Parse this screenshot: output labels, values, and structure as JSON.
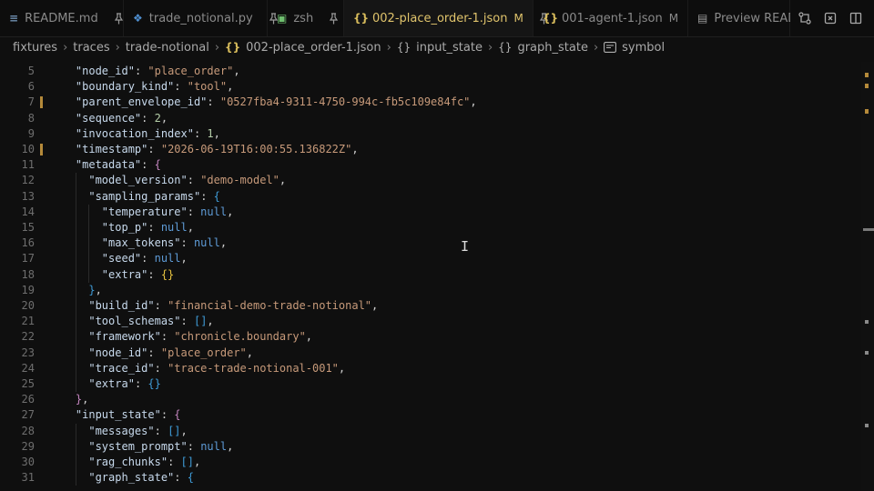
{
  "tabs": [
    {
      "label": "README.md",
      "icon": "info-icon",
      "glyph": "≡",
      "icon_color": "#6f8fb0",
      "modified": "",
      "pinned": true,
      "active": false
    },
    {
      "label": "trade_notional.py",
      "icon": "python-icon",
      "glyph": "❖",
      "icon_color": "#4f8fd0",
      "modified": "",
      "pinned": true,
      "active": false
    },
    {
      "label": "zsh",
      "icon": "terminal-icon",
      "glyph": "▣",
      "icon_color": "#6fbf6f",
      "modified": "",
      "pinned": true,
      "active": false
    },
    {
      "label": "002-place_order-1.json",
      "icon": "json-icon",
      "glyph": "{}",
      "icon_color": "#d9bd5c",
      "modified": "M",
      "pinned": true,
      "active": true
    },
    {
      "label": "001-agent-1.json",
      "icon": "json-icon",
      "glyph": "{}",
      "icon_color": "#d9bd5c",
      "modified": "M",
      "pinned": false,
      "active": false
    },
    {
      "label": "Preview READ",
      "icon": "preview-icon",
      "glyph": "▤",
      "icon_color": "#9a9a9a",
      "modified": "",
      "pinned": false,
      "active": false
    }
  ],
  "breadcrumb": {
    "parts": [
      "fixtures",
      "traces",
      "trade-notional"
    ],
    "file": "002-place_order-1.json",
    "obj1": "input_state",
    "obj2": "graph_state",
    "symbol": "symbol"
  },
  "code": {
    "first_line": 5,
    "modified_lines": [
      7,
      10
    ],
    "lines": [
      [
        [
          "p",
          "    "
        ],
        [
          "k",
          "\"node_id\""
        ],
        [
          "p",
          ": "
        ],
        [
          "s",
          "\"place_order\""
        ],
        [
          "p",
          ","
        ]
      ],
      [
        [
          "p",
          "    "
        ],
        [
          "k",
          "\"boundary_kind\""
        ],
        [
          "p",
          ": "
        ],
        [
          "s",
          "\"tool\""
        ],
        [
          "p",
          ","
        ]
      ],
      [
        [
          "p",
          "    "
        ],
        [
          "k",
          "\"parent_envelope_id\""
        ],
        [
          "p",
          ": "
        ],
        [
          "s",
          "\"0527fba4-9311-4750-994c-fb5c109e84fc\""
        ],
        [
          "p",
          ","
        ]
      ],
      [
        [
          "p",
          "    "
        ],
        [
          "k",
          "\"sequence\""
        ],
        [
          "p",
          ": "
        ],
        [
          "n",
          "2"
        ],
        [
          "p",
          ","
        ]
      ],
      [
        [
          "p",
          "    "
        ],
        [
          "k",
          "\"invocation_index\""
        ],
        [
          "p",
          ": "
        ],
        [
          "n",
          "1"
        ],
        [
          "p",
          ","
        ]
      ],
      [
        [
          "p",
          "    "
        ],
        [
          "k",
          "\"timestamp\""
        ],
        [
          "p",
          ": "
        ],
        [
          "s",
          "\"2026-06-19T16:00:55.136822Z\""
        ],
        [
          "p",
          ","
        ]
      ],
      [
        [
          "p",
          "    "
        ],
        [
          "k",
          "\"metadata\""
        ],
        [
          "p",
          ": "
        ],
        [
          "b1",
          "{"
        ]
      ],
      [
        [
          "p",
          "      "
        ],
        [
          "k",
          "\"model_version\""
        ],
        [
          "p",
          ": "
        ],
        [
          "s",
          "\"demo-model\""
        ],
        [
          "p",
          ","
        ]
      ],
      [
        [
          "p",
          "      "
        ],
        [
          "k",
          "\"sampling_params\""
        ],
        [
          "p",
          ": "
        ],
        [
          "b3",
          "{"
        ]
      ],
      [
        [
          "p",
          "        "
        ],
        [
          "k",
          "\"temperature\""
        ],
        [
          "p",
          ": "
        ],
        [
          "kw",
          "null"
        ],
        [
          "p",
          ","
        ]
      ],
      [
        [
          "p",
          "        "
        ],
        [
          "k",
          "\"top_p\""
        ],
        [
          "p",
          ": "
        ],
        [
          "kw",
          "null"
        ],
        [
          "p",
          ","
        ]
      ],
      [
        [
          "p",
          "        "
        ],
        [
          "k",
          "\"max_tokens\""
        ],
        [
          "p",
          ": "
        ],
        [
          "kw",
          "null"
        ],
        [
          "p",
          ","
        ]
      ],
      [
        [
          "p",
          "        "
        ],
        [
          "k",
          "\"seed\""
        ],
        [
          "p",
          ": "
        ],
        [
          "kw",
          "null"
        ],
        [
          "p",
          ","
        ]
      ],
      [
        [
          "p",
          "        "
        ],
        [
          "k",
          "\"extra\""
        ],
        [
          "p",
          ": "
        ],
        [
          "b2",
          "{}"
        ]
      ],
      [
        [
          "p",
          "      "
        ],
        [
          "b3",
          "}"
        ],
        [
          "p",
          ","
        ]
      ],
      [
        [
          "p",
          "      "
        ],
        [
          "k",
          "\"build_id\""
        ],
        [
          "p",
          ": "
        ],
        [
          "s",
          "\"financial-demo-trade-notional\""
        ],
        [
          "p",
          ","
        ]
      ],
      [
        [
          "p",
          "      "
        ],
        [
          "k",
          "\"tool_schemas\""
        ],
        [
          "p",
          ": "
        ],
        [
          "b3",
          "[]"
        ],
        [
          "p",
          ","
        ]
      ],
      [
        [
          "p",
          "      "
        ],
        [
          "k",
          "\"framework\""
        ],
        [
          "p",
          ": "
        ],
        [
          "s",
          "\"chronicle.boundary\""
        ],
        [
          "p",
          ","
        ]
      ],
      [
        [
          "p",
          "      "
        ],
        [
          "k",
          "\"node_id\""
        ],
        [
          "p",
          ": "
        ],
        [
          "s",
          "\"place_order\""
        ],
        [
          "p",
          ","
        ]
      ],
      [
        [
          "p",
          "      "
        ],
        [
          "k",
          "\"trace_id\""
        ],
        [
          "p",
          ": "
        ],
        [
          "s",
          "\"trace-trade-notional-001\""
        ],
        [
          "p",
          ","
        ]
      ],
      [
        [
          "p",
          "      "
        ],
        [
          "k",
          "\"extra\""
        ],
        [
          "p",
          ": "
        ],
        [
          "b3",
          "{}"
        ]
      ],
      [
        [
          "p",
          "    "
        ],
        [
          "b1",
          "}"
        ],
        [
          "p",
          ","
        ]
      ],
      [
        [
          "p",
          "    "
        ],
        [
          "k",
          "\"input_state\""
        ],
        [
          "p",
          ": "
        ],
        [
          "b1",
          "{"
        ]
      ],
      [
        [
          "p",
          "      "
        ],
        [
          "k",
          "\"messages\""
        ],
        [
          "p",
          ": "
        ],
        [
          "b3",
          "[]"
        ],
        [
          "p",
          ","
        ]
      ],
      [
        [
          "p",
          "      "
        ],
        [
          "k",
          "\"system_prompt\""
        ],
        [
          "p",
          ": "
        ],
        [
          "kw",
          "null"
        ],
        [
          "p",
          ","
        ]
      ],
      [
        [
          "p",
          "      "
        ],
        [
          "k",
          "\"rag_chunks\""
        ],
        [
          "p",
          ": "
        ],
        [
          "b3",
          "[]"
        ],
        [
          "p",
          ","
        ]
      ],
      [
        [
          "p",
          "      "
        ],
        [
          "k",
          "\"graph_state\""
        ],
        [
          "p",
          ": "
        ],
        [
          "b3",
          "{"
        ]
      ]
    ]
  },
  "colors": {
    "background": "#0f0f0f",
    "active_tab_text": "#e0c46c",
    "string": "#c79a7a",
    "key": "#c7d9ec",
    "keyword": "#5e9bd6"
  },
  "text_cursor": "I"
}
